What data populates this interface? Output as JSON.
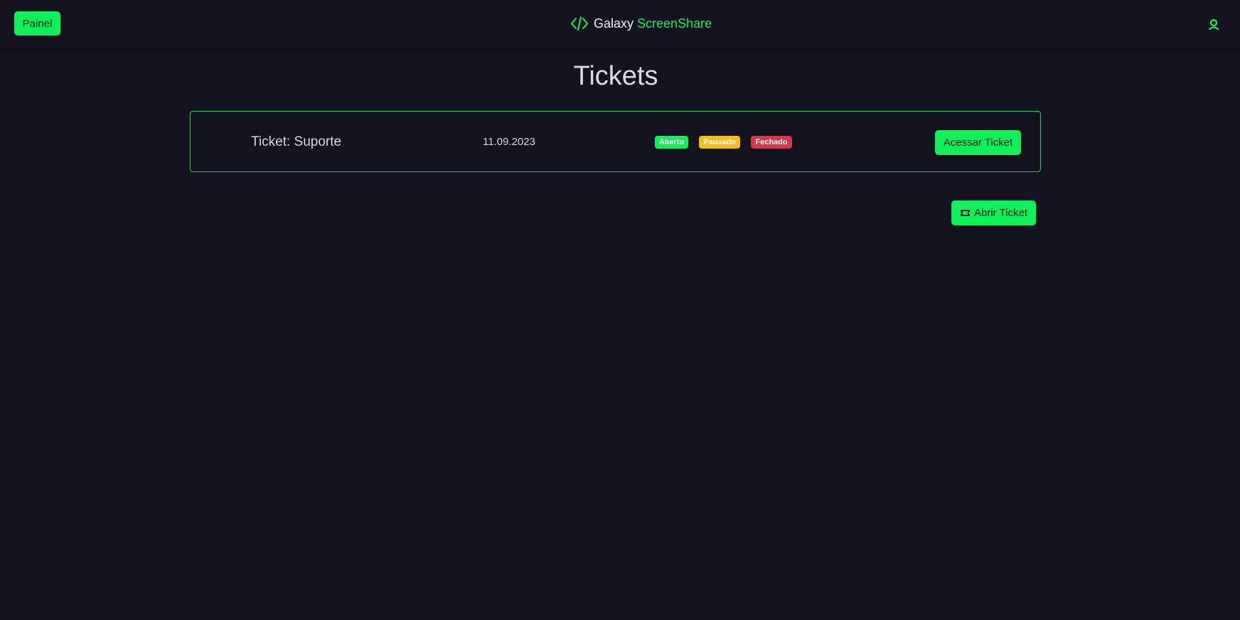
{
  "header": {
    "painel_label": "Painel",
    "brand_primary": "Galaxy",
    "brand_secondary": "ScreenShare",
    "brand_icon": "code-icon",
    "user_icon": "user-icon"
  },
  "page": {
    "title": "Tickets"
  },
  "tickets": [
    {
      "name": "Ticket: Suporte",
      "date": "11.09.2023",
      "badges": [
        "Aberto",
        "Pausado",
        "Fechado"
      ],
      "action_label": "Acessar Ticket"
    }
  ],
  "actions": {
    "open_ticket_label": "Abrir Ticket",
    "open_ticket_icon": "ticket-icon"
  },
  "colors": {
    "background": "#13121f",
    "accent": "#0cf15a",
    "badge_aberto": "#0cf15a",
    "badge_pausado": "#f7bd15",
    "badge_fechado": "#d8344a"
  }
}
